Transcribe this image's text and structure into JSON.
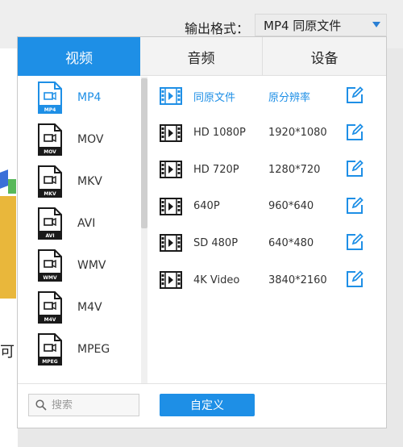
{
  "background": {
    "partial_char": "可"
  },
  "format_bar": {
    "label": "输出格式：",
    "selected": "MP4  同原文件"
  },
  "tabs": [
    {
      "label": "视频",
      "active": true
    },
    {
      "label": "音频",
      "active": false
    },
    {
      "label": "设备",
      "active": false
    }
  ],
  "formats": [
    {
      "label": "MP4",
      "badge": "MP4",
      "selected": true
    },
    {
      "label": "MOV",
      "badge": "MOV",
      "selected": false
    },
    {
      "label": "MKV",
      "badge": "MKV",
      "selected": false
    },
    {
      "label": "AVI",
      "badge": "AVI",
      "selected": false
    },
    {
      "label": "WMV",
      "badge": "WMV",
      "selected": false
    },
    {
      "label": "M4V",
      "badge": "M4V",
      "selected": false
    },
    {
      "label": "MPEG",
      "badge": "MPEG",
      "selected": false
    }
  ],
  "presets": [
    {
      "name": "同原文件",
      "resolution": "原分辨率",
      "selected": true
    },
    {
      "name": "HD 1080P",
      "resolution": "1920*1080",
      "selected": false
    },
    {
      "name": "HD 720P",
      "resolution": "1280*720",
      "selected": false
    },
    {
      "name": "640P",
      "resolution": "960*640",
      "selected": false
    },
    {
      "name": "SD 480P",
      "resolution": "640*480",
      "selected": false
    },
    {
      "name": "4K Video",
      "resolution": "3840*2160",
      "selected": false
    }
  ],
  "search": {
    "placeholder": "搜索"
  },
  "custom_button": {
    "label": "自定义"
  },
  "colors": {
    "accent": "#1e8fe6",
    "dark_icon": "#1a1a1a"
  }
}
